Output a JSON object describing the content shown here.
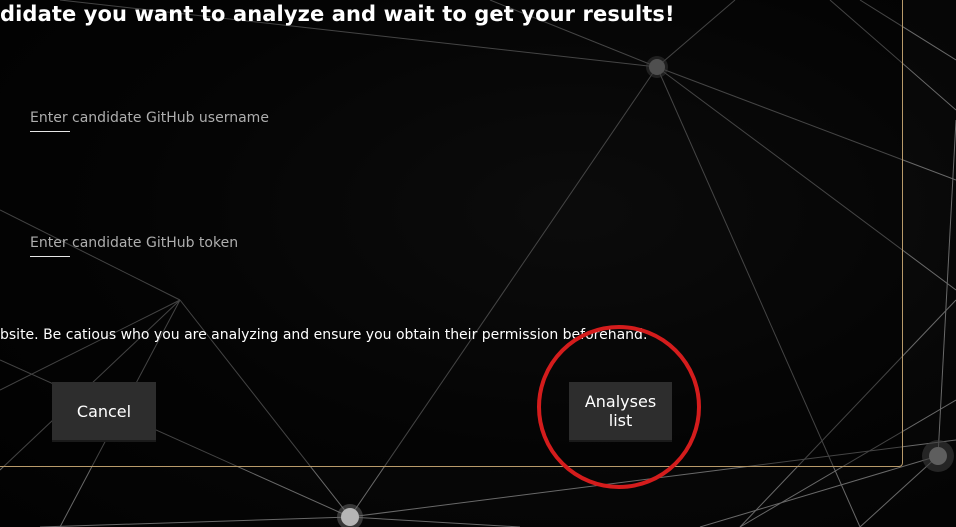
{
  "heading": "didate you want to analyze and wait to get your results!",
  "form": {
    "username_placeholder": "Enter candidate GitHub username",
    "username_value": "",
    "token_placeholder": "Enter candidate GitHub token",
    "token_value": ""
  },
  "warning_text": "bsite. Be catious who you are analyzing and ensure you obtain their permission beforehand.",
  "buttons": {
    "cancel_label": "Cancel",
    "analyses_list_label": "Analyses list"
  },
  "colors": {
    "background": "#050505",
    "panel_border": "#b89a6a",
    "button_bg": "#2d2d2d",
    "highlight_ring": "#d41c1c"
  }
}
